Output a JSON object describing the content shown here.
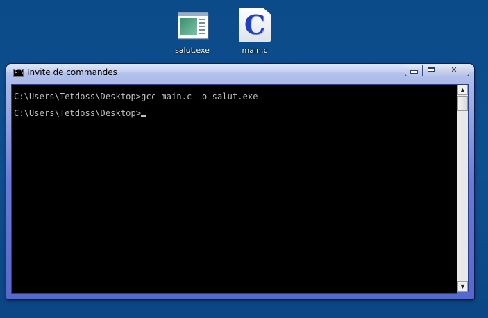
{
  "desktop": {
    "icons": [
      {
        "label": "salut.exe",
        "icon": "exe-file-icon"
      },
      {
        "label": "main.c",
        "icon": "c-source-file-icon"
      }
    ]
  },
  "window": {
    "title": "Invite de commandes",
    "title_icon": "cmd-icon",
    "buttons": {
      "minimize": "minimize-icon",
      "maximize": "maximize-icon",
      "close": "close-icon"
    }
  },
  "console": {
    "lines": [
      "C:\\Users\\Tetdoss\\Desktop>gcc main.c -o salut.exe",
      "C:\\Users\\Tetdoss\\Desktop>"
    ]
  },
  "colors": {
    "desktop_bg": "#0f4d8c",
    "console_bg": "#000000",
    "console_text": "#c0c0c0"
  }
}
